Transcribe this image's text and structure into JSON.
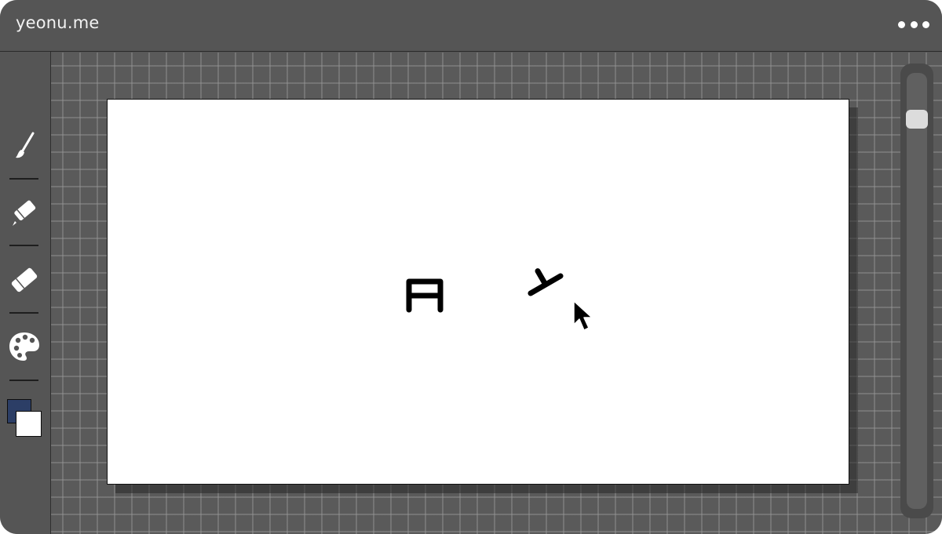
{
  "app": {
    "title": "yeonu.me",
    "menu_icon": "more-horizontal-icon"
  },
  "toolbar": {
    "tools": [
      {
        "name": "brush",
        "icon": "brush-icon"
      },
      {
        "name": "pencil-eraser",
        "icon": "pencil-eraser-icon"
      },
      {
        "name": "eraser",
        "icon": "eraser-icon"
      },
      {
        "name": "palette",
        "icon": "palette-icon"
      }
    ],
    "foreground_color": "#2c3e66",
    "background_color": "#ffffff"
  },
  "canvas": {
    "background": "#ffffff",
    "strokes": [
      "ㅂ",
      "ㅜ"
    ],
    "cursor_icon": "pointer-cursor-icon"
  },
  "zoom_slider": {
    "level": 0.1
  },
  "colors": {
    "titlebar": "#555555",
    "workspace": "#5a5a5a",
    "grid": "#8a8a8a",
    "stroke": "#000000"
  }
}
